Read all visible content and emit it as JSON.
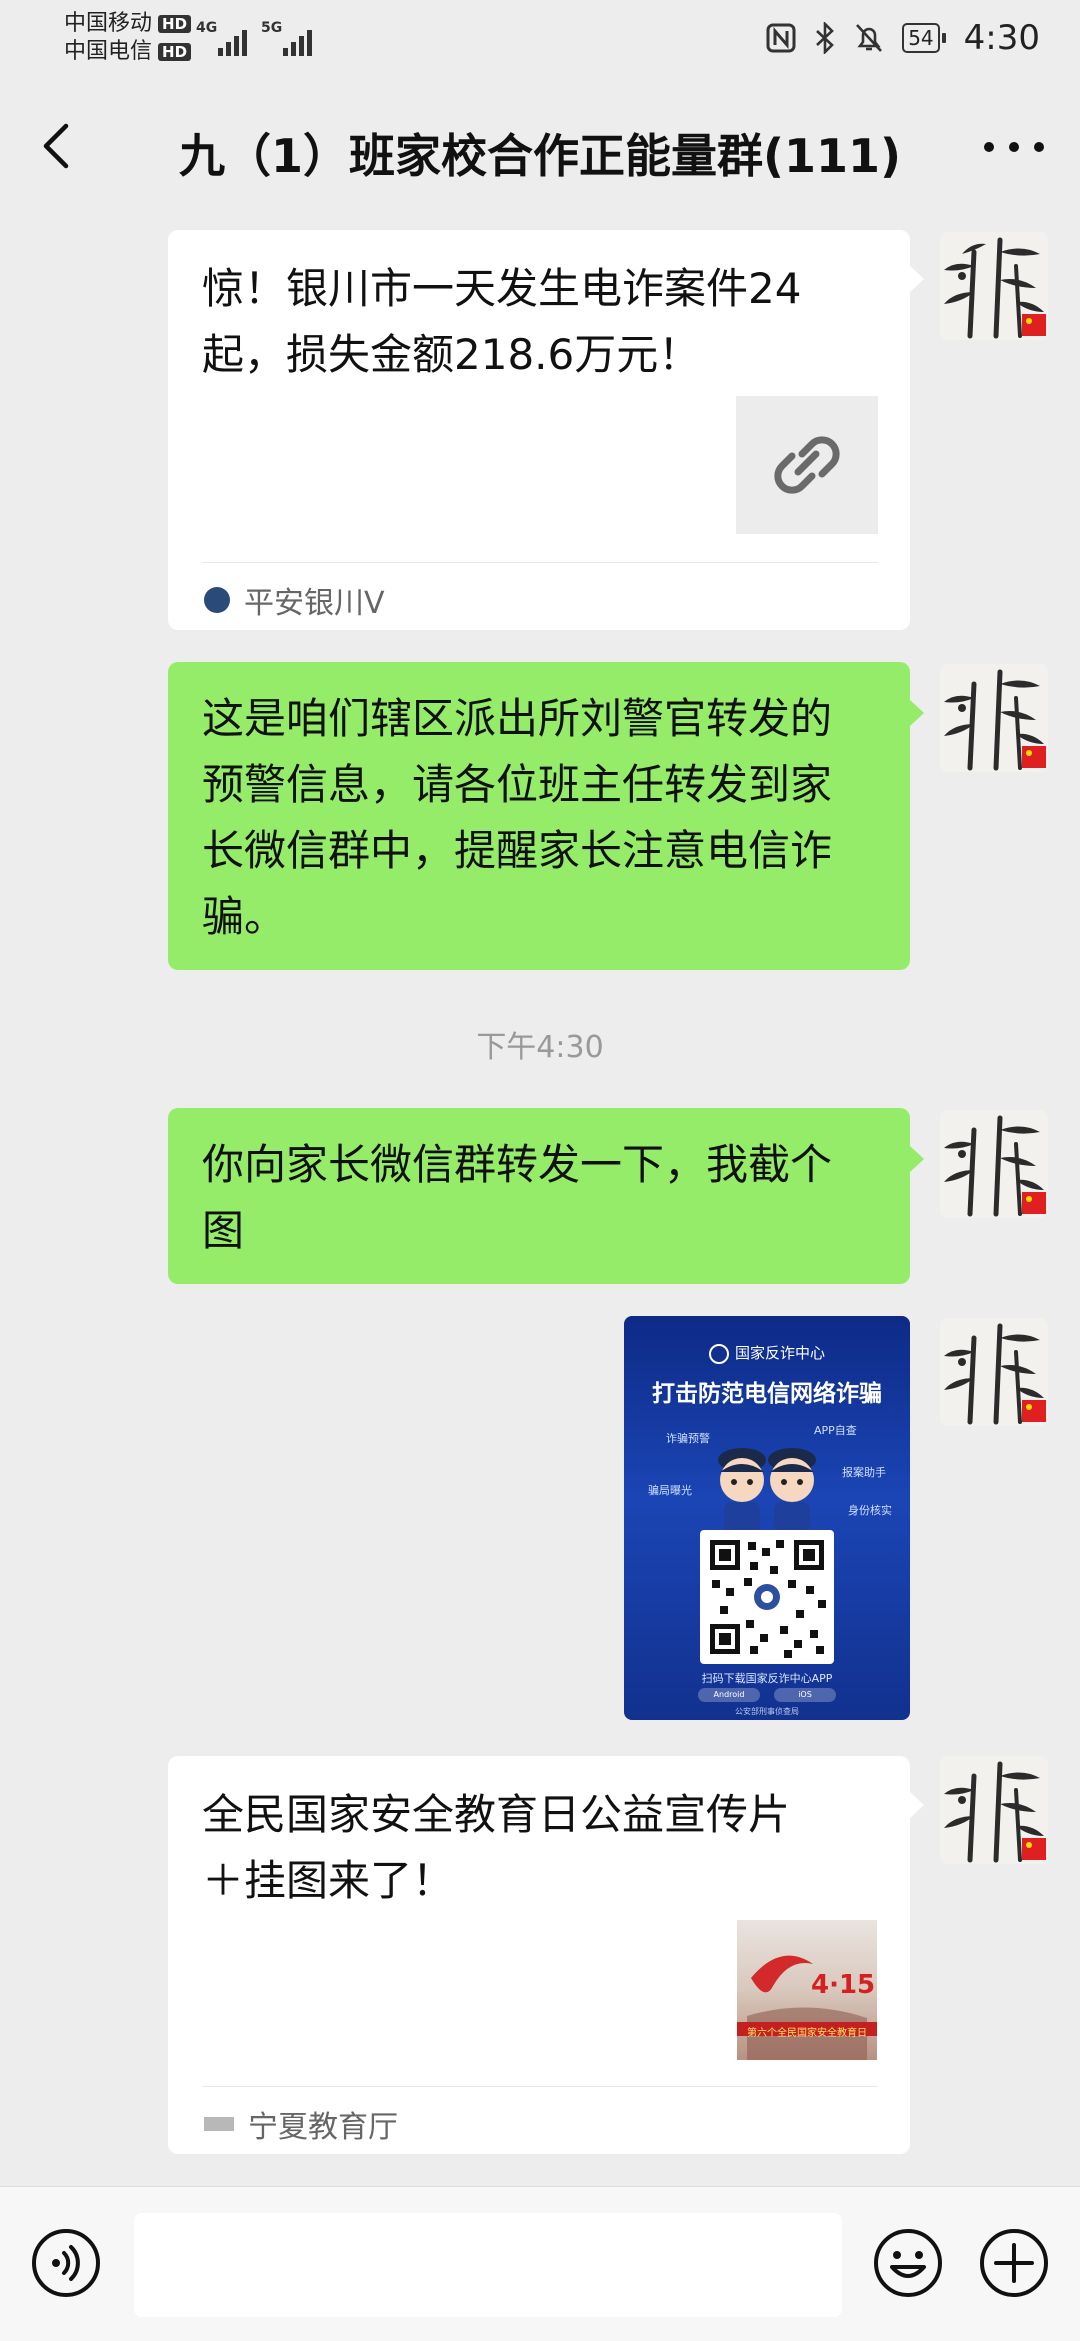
{
  "status_bar": {
    "carrier1": "中国移动",
    "carrier2": "中国电信",
    "hd": "HD",
    "net1": "4G",
    "net2": "5G",
    "battery": "54",
    "time": "4:30"
  },
  "header": {
    "title": "九（1）班家校合作正能量群(111)"
  },
  "messages": [
    {
      "type": "link-card",
      "line1": "惊！银川市一天发生电诈案件24",
      "line2": "起，损失金额218.6万元！",
      "source": "平安银川V"
    },
    {
      "type": "text",
      "lines": [
        "这是咱们辖区派出所刘警官转发的",
        "预警信息，请各位班主任转发到家",
        "长微信群中，提醒家长注意电信诈",
        "骗。"
      ]
    },
    {
      "type": "timestamp",
      "text": "下午4:30"
    },
    {
      "type": "text",
      "lines": [
        "你向家长微信群转发一下，我截个",
        "图"
      ]
    },
    {
      "type": "image",
      "poster": {
        "org": "国家反诈中心",
        "headline": "打击防范电信网络诈骗",
        "labels": [
          "诈骗预警",
          "APP自查",
          "报案助手",
          "骗局曝光",
          "身份核实"
        ],
        "caption": "扫码下载国家反诈中心APP",
        "btn1": "Android",
        "btn2": "iOS",
        "footer": "公安部刑事侦查局"
      }
    },
    {
      "type": "link-card",
      "line1": "全民国家安全教育日公益宣传片",
      "line2": "＋挂图来了！",
      "thumb_text": "4·15",
      "thumb_caption": "第六个全民国家安全教育日",
      "source": "宁夏教育厅"
    }
  ],
  "colors": {
    "background": "#ededed",
    "green_bubble": "#95ec69",
    "white_bubble": "#ffffff"
  },
  "icons": {
    "back": "chevron-left-icon",
    "more": "more-dots-icon",
    "voice": "voice-icon",
    "emoji": "emoji-icon",
    "plus": "plus-icon",
    "link": "link-icon"
  }
}
